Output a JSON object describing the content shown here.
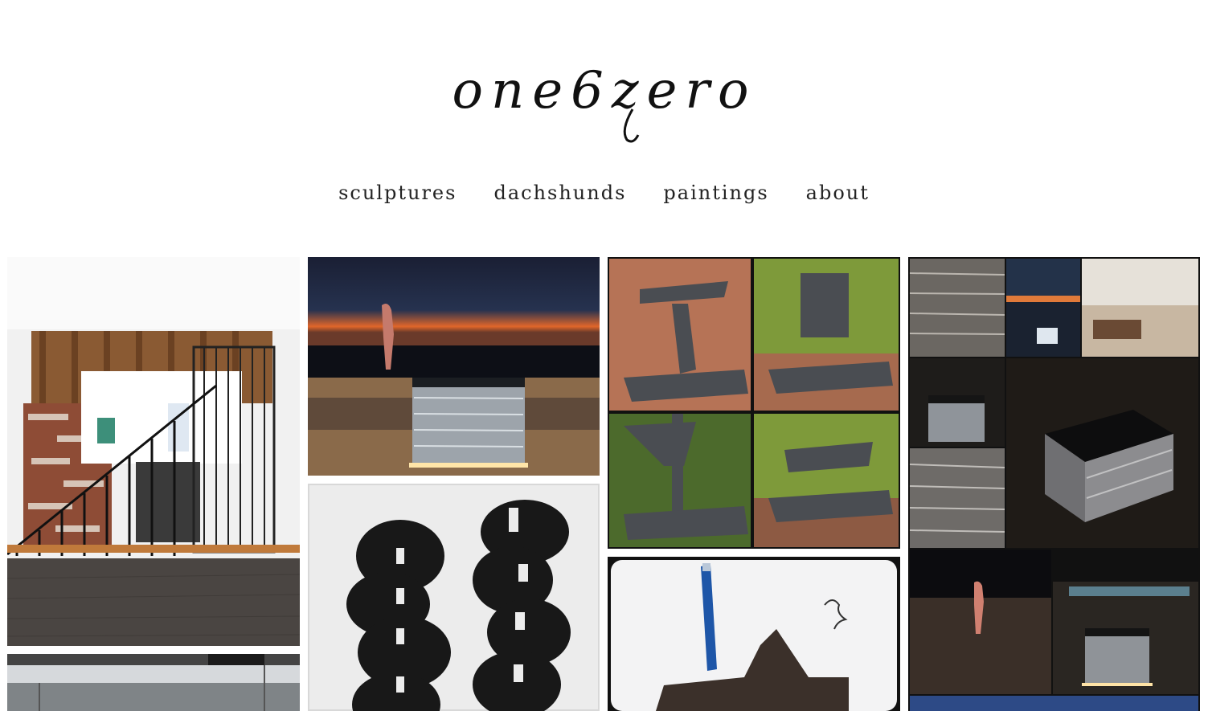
{
  "site": {
    "logo_text": "one6zero"
  },
  "nav": {
    "items": [
      {
        "label": "sculptures"
      },
      {
        "label": "dachshunds"
      },
      {
        "label": "paintings"
      },
      {
        "label": "about"
      }
    ]
  },
  "gallery": {
    "tiles": [
      {
        "subject": "installation-with-pallets-and-gate"
      },
      {
        "subject": "sunset-figure-and-lit-box"
      },
      {
        "subject": "black-cutout-sculptures"
      },
      {
        "subject": "steel-sculpture-collage"
      },
      {
        "subject": "pen-and-steel-sculpture"
      },
      {
        "subject": "lit-box-at-dusk-collage"
      },
      {
        "subject": "street-scene-with-signage"
      }
    ]
  }
}
